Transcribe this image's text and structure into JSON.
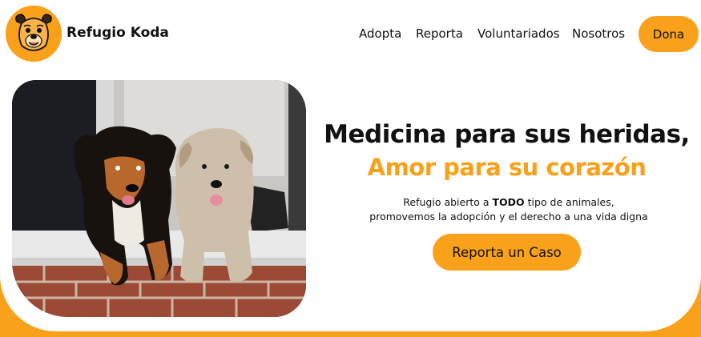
{
  "brand": {
    "name": "Refugio Koda",
    "logo_icon": "dog-face-icon"
  },
  "nav": {
    "items": [
      {
        "label": "Adopta"
      },
      {
        "label": "Reporta"
      },
      {
        "label": "Voluntariados"
      },
      {
        "label": "Nosotros"
      }
    ],
    "donate_label": "Dona"
  },
  "hero": {
    "headline": "Medicina para sus heridas,",
    "subheadline": "Amor para su corazón",
    "description_pre": "Refugio abierto a ",
    "description_bold": "TODO",
    "description_post": " tipo de animales,",
    "description_line2": "promovemos la adopción y el derecho a una vida digna",
    "cta_label": "Reporta un Caso",
    "photo_icon": "two-dogs-photo"
  },
  "colors": {
    "accent": "#f9a11b",
    "text": "#111111",
    "background": "#ffffff"
  }
}
